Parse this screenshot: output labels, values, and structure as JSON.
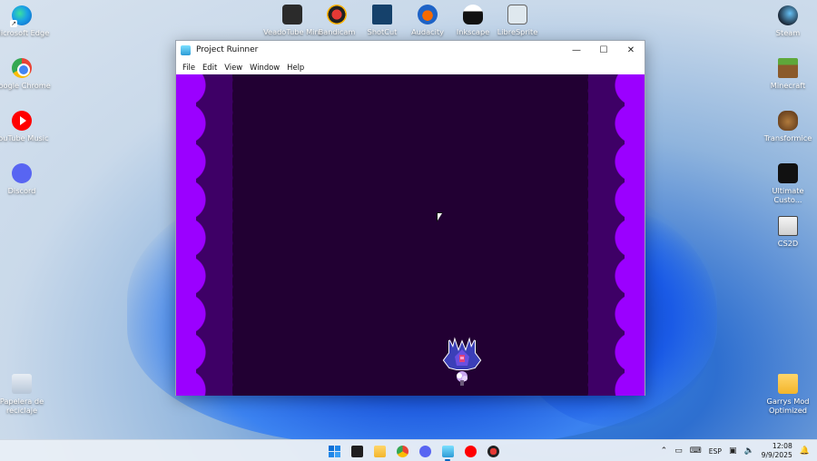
{
  "desktop": {
    "left_icons": [
      {
        "label": "Microsoft Edge",
        "icon": "edge-icon"
      },
      {
        "label": "Google Chrome",
        "icon": "chrome-icon"
      },
      {
        "label": "YouTube Music",
        "icon": "youtube-music-icon"
      },
      {
        "label": "Discord",
        "icon": "discord-icon"
      },
      {
        "label": "Papelera de reciclaje",
        "icon": "recycle-bin-icon"
      }
    ],
    "top_icons": [
      {
        "label": "VeadoTube Mini",
        "icon": "veadotube-icon"
      },
      {
        "label": "Bandicam",
        "icon": "bandicam-icon"
      },
      {
        "label": "ShotCut",
        "icon": "shotcut-icon"
      },
      {
        "label": "Audacity",
        "icon": "audacity-icon"
      },
      {
        "label": "Inkscape",
        "icon": "inkscape-icon"
      },
      {
        "label": "LibreSprite",
        "icon": "libresprite-icon"
      }
    ],
    "right_icons": [
      {
        "label": "Steam",
        "icon": "steam-icon"
      },
      {
        "label": "Minecraft",
        "icon": "minecraft-icon"
      },
      {
        "label": "Transformice",
        "icon": "transformice-icon"
      },
      {
        "label": "Ultimate Custo...",
        "icon": "ultimate-custom-night-icon"
      },
      {
        "label": "CS2D",
        "icon": "cs2d-icon"
      },
      {
        "label": "Garrys Mod Optimized",
        "icon": "folder-icon"
      }
    ]
  },
  "window": {
    "title": "Project Ruinner",
    "controls": {
      "minimize": "—",
      "maximize": "☐",
      "close": "✕"
    },
    "menu": [
      "File",
      "Edit",
      "View",
      "Window",
      "Help"
    ]
  },
  "taskbar": {
    "language": "ESP",
    "time": "12:08",
    "date": "9/9/2025"
  },
  "colors": {
    "game_bg": "#220033",
    "wall_dark": "#3e0066",
    "wall_light": "#9b00ff",
    "accent": "#0067c0"
  }
}
